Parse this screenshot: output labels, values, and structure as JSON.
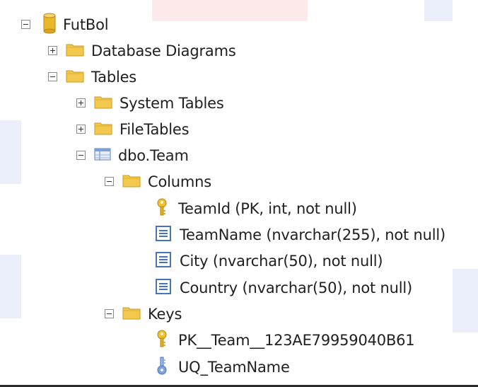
{
  "tree": {
    "database": {
      "label": "FutBol",
      "icon": "database-icon",
      "expanded": true
    },
    "nodes": [
      {
        "id": "database-diagrams",
        "label": "Database Diagrams",
        "icon": "folder-icon",
        "expanded": false
      },
      {
        "id": "tables",
        "label": "Tables",
        "icon": "folder-icon",
        "expanded": true
      },
      {
        "id": "system-tables",
        "label": "System Tables",
        "icon": "folder-icon",
        "expanded": false
      },
      {
        "id": "filetables",
        "label": "FileTables",
        "icon": "folder-icon",
        "expanded": false
      },
      {
        "id": "dbo-team",
        "label": "dbo.Team",
        "icon": "table-icon",
        "expanded": true
      },
      {
        "id": "columns",
        "label": "Columns",
        "icon": "folder-icon",
        "expanded": true
      },
      {
        "id": "col-teamid",
        "label": "TeamId (PK, int, not null)",
        "icon": "primary-key-icon"
      },
      {
        "id": "col-teamname",
        "label": "TeamName (nvarchar(255), not null)",
        "icon": "column-icon"
      },
      {
        "id": "col-city",
        "label": "City (nvarchar(50), not null)",
        "icon": "column-icon"
      },
      {
        "id": "col-country",
        "label": "Country (nvarchar(50), not null)",
        "icon": "column-icon"
      },
      {
        "id": "keys",
        "label": "Keys",
        "icon": "folder-icon",
        "expanded": true
      },
      {
        "id": "key-pk",
        "label": "PK__Team__123AE79959040B61",
        "icon": "primary-key-icon"
      },
      {
        "id": "key-uq",
        "label": "UQ_TeamName",
        "icon": "unique-key-icon"
      }
    ]
  },
  "colors": {
    "folder": "#f2c94c",
    "folder_dark": "#d9a520",
    "key": "#e0b020",
    "column_icon": "#4a74b8",
    "unique_key": "#5b8ad6"
  }
}
